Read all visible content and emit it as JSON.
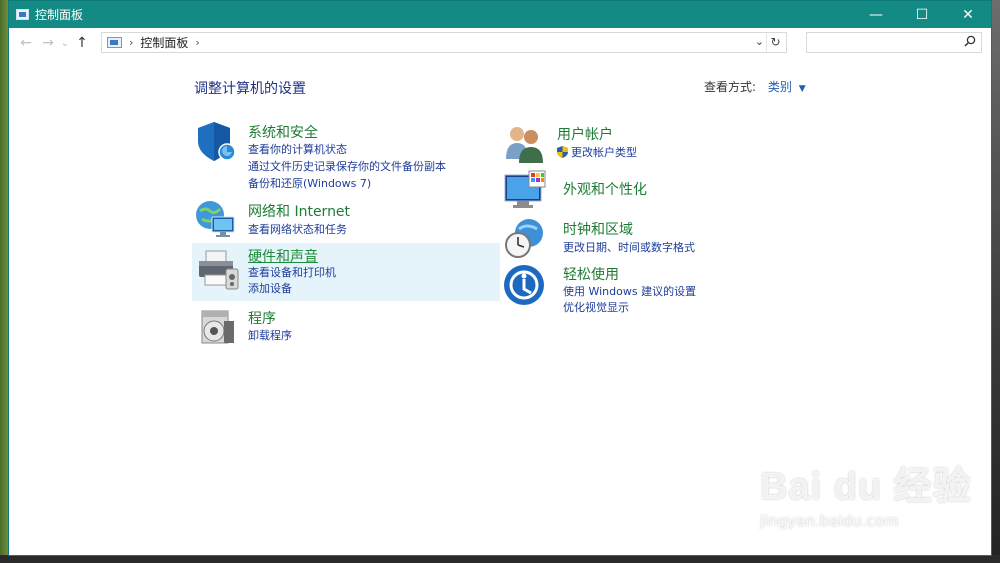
{
  "window": {
    "title": "控制面板",
    "controls": {
      "minimize": "—",
      "maximize": "☐",
      "close": "✕"
    }
  },
  "addressbar": {
    "back": "←",
    "forward": "→",
    "recent": "⌄",
    "up": "↑",
    "breadcrumb": "控制面板",
    "separator": "›",
    "dropdown": "⌄",
    "refresh": "↻",
    "search_placeholder": "",
    "search_icon": "search-icon"
  },
  "content": {
    "heading": "调整计算机的设置",
    "view_by": {
      "label": "查看方式:",
      "value": "类别",
      "caret": "▼"
    },
    "categories": [
      {
        "title": "系统和安全",
        "icon": "shield-icon",
        "links": [
          "查看你的计算机状态",
          "通过文件历史记录保存你的文件备份副本",
          "备份和还原(Windows 7)"
        ]
      },
      {
        "title": "网络和 Internet",
        "icon": "network-globe-icon",
        "links": [
          "查看网络状态和任务"
        ]
      },
      {
        "title": "硬件和声音",
        "icon": "printer-icon",
        "links": [
          "查看设备和打印机",
          "添加设备"
        ]
      },
      {
        "title": "程序",
        "icon": "programs-disc-icon",
        "links": [
          "卸载程序"
        ]
      },
      {
        "title": "用户帐户",
        "icon": "users-icon",
        "links": [
          "更改帐户类型"
        ]
      },
      {
        "title": "外观和个性化",
        "icon": "monitor-palette-icon",
        "links": []
      },
      {
        "title": "时钟和区域",
        "icon": "clock-globe-icon",
        "links": [
          "更改日期、时间或数字格式"
        ]
      },
      {
        "title": "轻松使用",
        "icon": "ease-of-access-icon",
        "links": [
          "使用 Windows 建议的设置",
          "优化视觉显示"
        ]
      }
    ]
  },
  "watermark": {
    "brand": "Bai du 经验",
    "url": "jingyan.baidu.com"
  },
  "colors": {
    "titlebar": "#138a84",
    "category_title": "#1d7c34",
    "link": "#1e3d9a",
    "heading": "#1e3287",
    "highlight": "#e5f3fb"
  }
}
